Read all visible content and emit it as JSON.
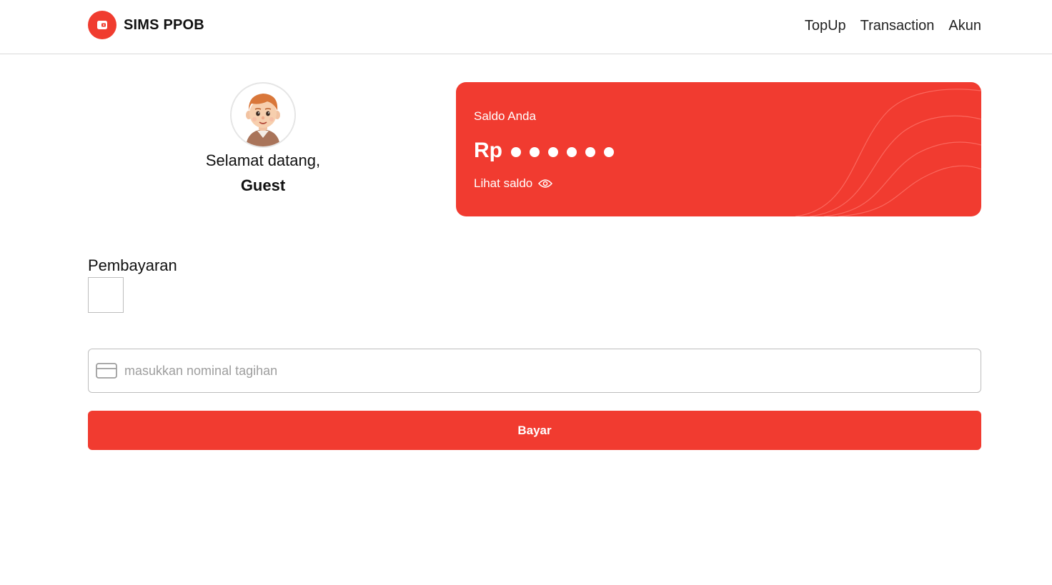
{
  "app": {
    "name": "SIMS PPOB",
    "logo_icon": "wallet-icon",
    "brand_color": "#f13b30"
  },
  "nav": {
    "items": [
      {
        "label": "TopUp"
      },
      {
        "label": "Transaction"
      },
      {
        "label": "Akun"
      }
    ]
  },
  "profile": {
    "greeting": "Selamat datang,",
    "name": "Guest",
    "avatar_icon": "avatar-cartoon-boy"
  },
  "saldo": {
    "label": "Saldo Anda",
    "currency": "Rp",
    "masked_dots": 6,
    "toggle_label": "Lihat saldo",
    "toggle_icon": "eye-icon"
  },
  "payment": {
    "title": "Pembayaran",
    "amount_placeholder": "masukkan nominal tagihan",
    "amount_value": "",
    "input_icon": "credit-card-icon",
    "submit_label": "Bayar"
  }
}
